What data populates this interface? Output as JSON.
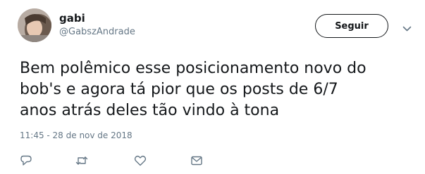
{
  "user": {
    "name": "gabi",
    "handle": "@GabszAndrade"
  },
  "follow_button": {
    "label": "Seguir"
  },
  "tweet": {
    "text": "Bem polêmico esse posicionamento novo do\nbob's e agora tá pior que os posts de 6/7\nanos atrás deles tão vindo à tona",
    "timestamp": "11:45 - 28 de nov de 2018"
  },
  "icons": {
    "menu": "chevron-down-icon",
    "reply": "reply-icon",
    "retweet": "retweet-icon",
    "like": "heart-icon",
    "dm": "envelope-icon"
  },
  "colors": {
    "text": "#14171a",
    "muted": "#657786",
    "icon": "#657786"
  }
}
